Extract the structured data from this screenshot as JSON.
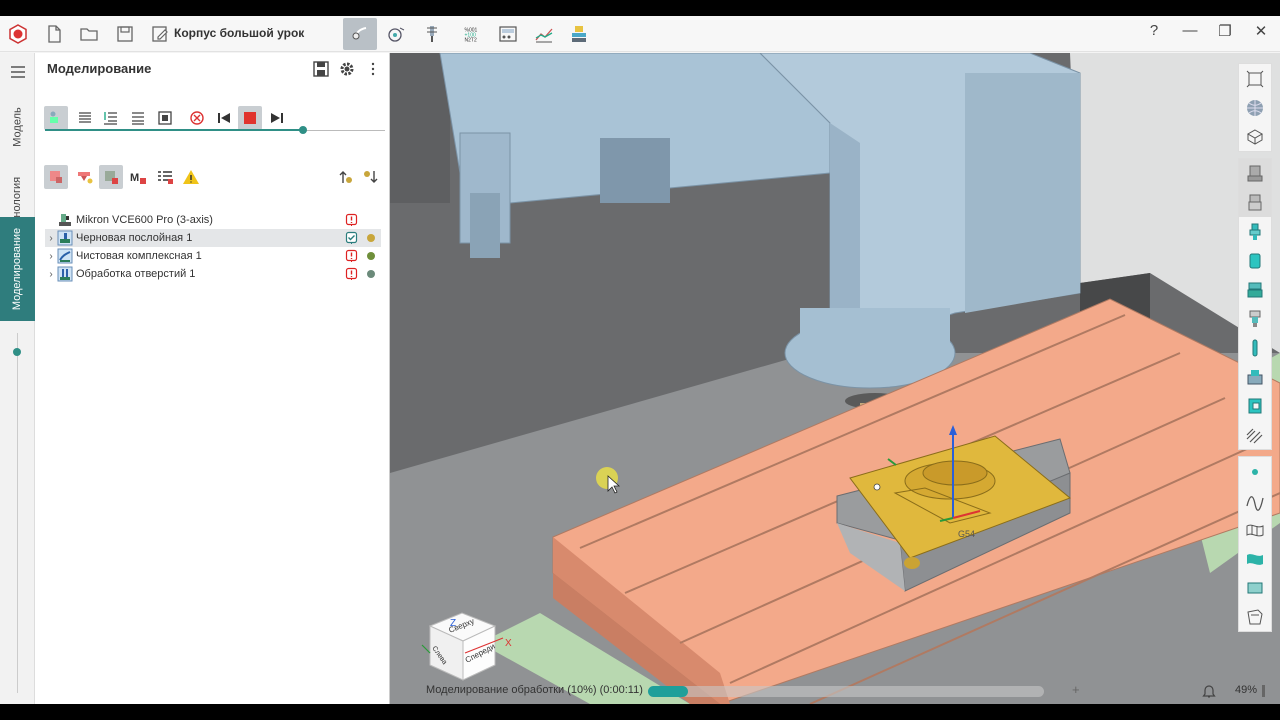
{
  "titlebar": {
    "document_title": "Корпус большой урок",
    "help_label": "?",
    "minimize_label": "—",
    "restore_label": "❐",
    "close_label": "✕"
  },
  "rail": {
    "tabs": [
      {
        "label": "Модель"
      },
      {
        "label": "Технология"
      },
      {
        "label": "Моделирование"
      }
    ]
  },
  "panel": {
    "title": "Моделирование",
    "progress_fraction": 0.76
  },
  "tree": {
    "machine": "Mikron VCE600 Pro (3-axis)",
    "operations": [
      {
        "label": "Черновая послойная 1",
        "status": "ok",
        "dot_color": "#c8a63b"
      },
      {
        "label": "Чистовая комплексная 1",
        "status": "warn",
        "dot_color": "#6f8f3a"
      },
      {
        "label": "Обработка отверстий 1",
        "status": "warn",
        "dot_color": "#6b8a7a"
      }
    ]
  },
  "viewcube": {
    "top": "Сверху",
    "front": "Спереди",
    "left": "Слева",
    "axis_x": "X",
    "axis_z": "Z"
  },
  "scene": {
    "part_label": "G54"
  },
  "status": {
    "text": "Моделирование обработки (10%) (0:00:11)",
    "progress_fraction": 0.1,
    "zoom": "49%"
  },
  "colors": {
    "accent": "#2f7d7d",
    "table": "#f3a98a",
    "part": "#e0b83d",
    "spindle": "#a9c3d6"
  }
}
